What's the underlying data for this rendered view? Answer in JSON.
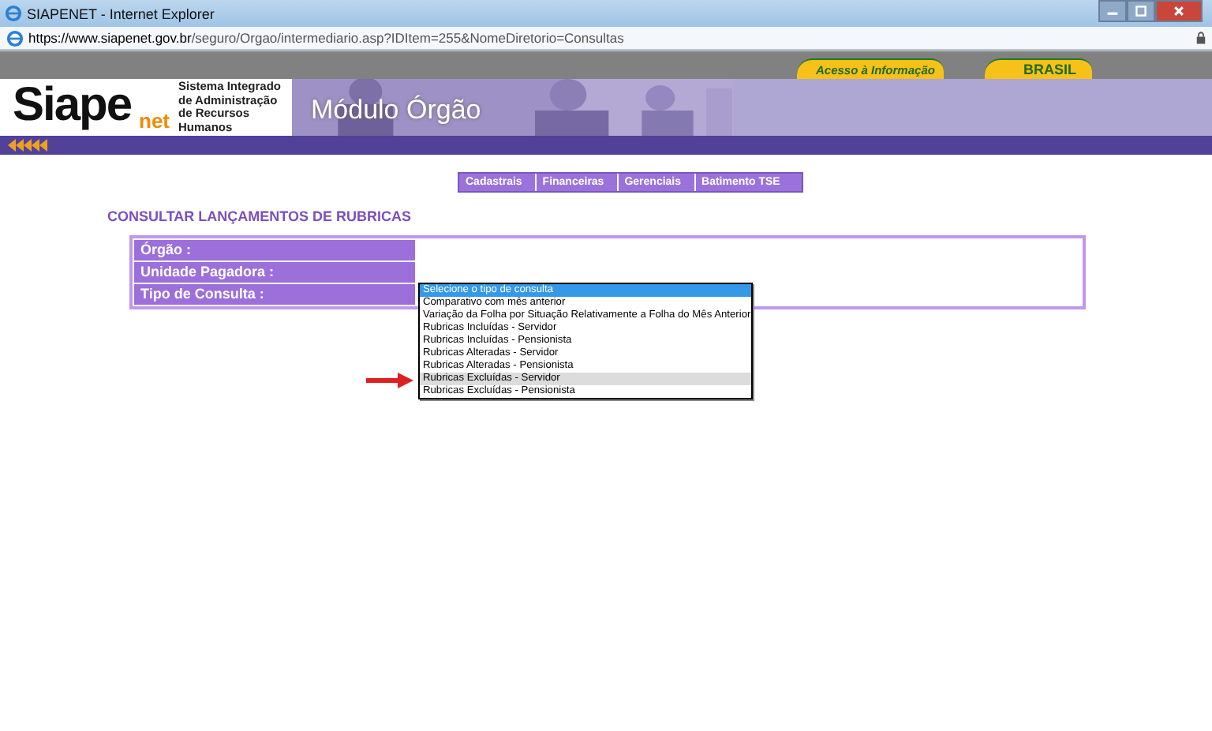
{
  "window": {
    "title": "SIAPENET - Internet Explorer"
  },
  "address_bar": {
    "url_domain": "https://www.siapenet.gov.br",
    "url_path": "/seguro/Orgao/intermediario.asp?IDItem=255&NomeDiretorio=Consultas"
  },
  "top_links": [
    "Acesso à Informação",
    "BRASIL"
  ],
  "banner": {
    "logo": "Siape",
    "logo_sub": "net",
    "system_name": "Sistema Integrado de Administração de Recursos Humanos",
    "module": "Módulo Órgão"
  },
  "menu": [
    "Cadastrais",
    "Financeiras",
    "Gerenciais",
    "Batimento TSE"
  ],
  "heading": "CONSULTAR LANÇAMENTOS DE RUBRICAS",
  "form": {
    "fields": [
      {
        "label": "Órgão :"
      },
      {
        "label": "Unidade Pagadora :"
      },
      {
        "label": "Tipo de Consulta :"
      }
    ]
  },
  "dropdown": {
    "options": [
      {
        "text": "Selecione o tipo de consulta",
        "selected": true,
        "hovered": false
      },
      {
        "text": "Comparativo com mês anterior",
        "selected": false,
        "hovered": false
      },
      {
        "text": "Variação da Folha por Situação Relativamente a Folha do Mês Anterior",
        "selected": false,
        "hovered": false
      },
      {
        "text": "Rubricas Incluídas - Servidor",
        "selected": false,
        "hovered": false
      },
      {
        "text": "Rubricas Incluídas - Pensionista",
        "selected": false,
        "hovered": false
      },
      {
        "text": "Rubricas Alteradas - Servidor",
        "selected": false,
        "hovered": false
      },
      {
        "text": "Rubricas Alteradas - Pensionista",
        "selected": false,
        "hovered": false
      },
      {
        "text": "Rubricas Excluídas - Servidor",
        "selected": false,
        "hovered": true
      },
      {
        "text": "Rubricas Excluídas - Pensionista",
        "selected": false,
        "hovered": false
      }
    ]
  }
}
